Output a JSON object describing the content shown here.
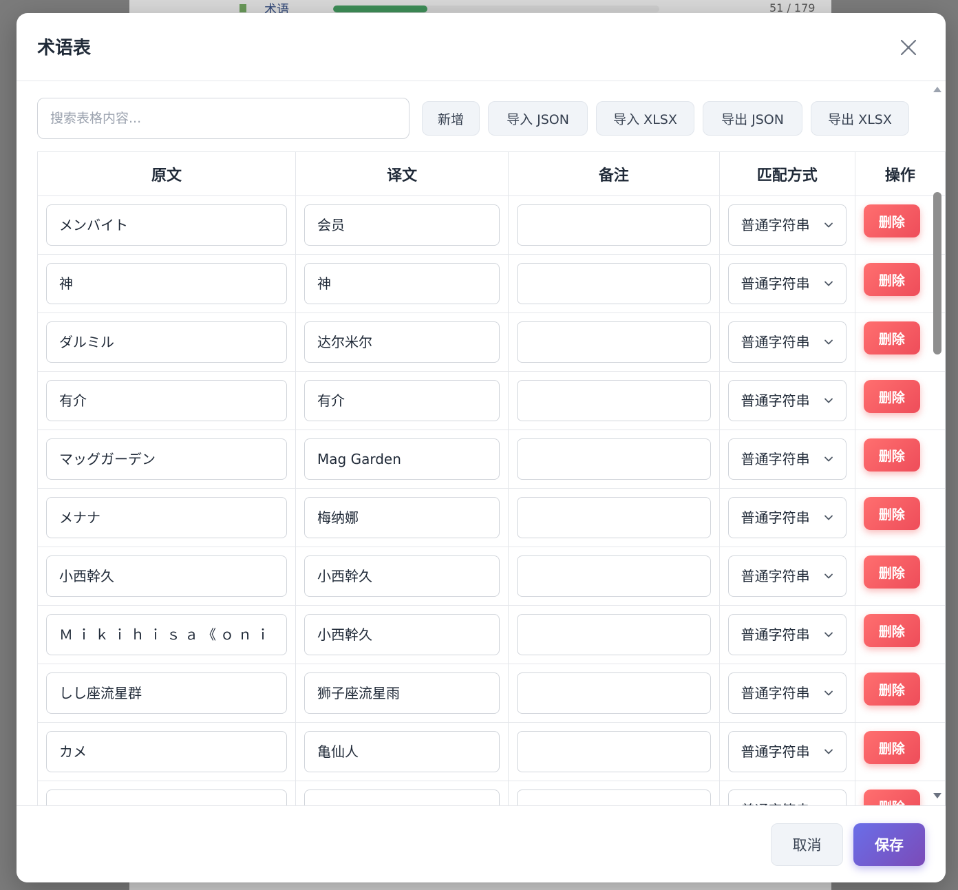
{
  "background": {
    "title": "术语",
    "count": "51 / 179",
    "progress": 0.29
  },
  "modal": {
    "title": "术语表",
    "close_icon": "close-icon",
    "search": {
      "placeholder": "搜索表格内容...",
      "value": ""
    },
    "toolbar": {
      "add_label": "新增",
      "import_json_label": "导入 JSON",
      "import_xlsx_label": "导入 XLSX",
      "export_json_label": "导出 JSON",
      "export_xlsx_label": "导出 XLSX"
    },
    "table": {
      "headers": [
        "原文",
        "译文",
        "备注",
        "匹配方式",
        "操作"
      ],
      "rows": [
        {
          "source": "メンバイト",
          "target": "会员",
          "note": "",
          "match": "普通字符串",
          "action": "删除"
        },
        {
          "source": "神",
          "target": "神",
          "note": "",
          "match": "普通字符串",
          "action": "删除"
        },
        {
          "source": "ダルミル",
          "target": "达尔米尔",
          "note": "",
          "match": "普通字符串",
          "action": "删除"
        },
        {
          "source": "有介",
          "target": "有介",
          "note": "",
          "match": "普通字符串",
          "action": "删除"
        },
        {
          "source": "マッグガーデン",
          "target": "Mag Garden",
          "note": "",
          "match": "普通字符串",
          "action": "删除"
        },
        {
          "source": "メナナ",
          "target": "梅纳娜",
          "note": "",
          "match": "普通字符串",
          "action": "删除"
        },
        {
          "source": "小西幹久",
          "target": "小西幹久",
          "note": "",
          "match": "普通字符串",
          "action": "删除"
        },
        {
          "source": "Ｍｉｋｉｈｉｓａ《ｏｎｉ",
          "target": "小西幹久",
          "note": "",
          "match": "普通字符串",
          "action": "删除"
        },
        {
          "source": "しし座流星群",
          "target": "狮子座流星雨",
          "note": "",
          "match": "普通字符串",
          "action": "删除"
        },
        {
          "source": "カメ",
          "target": "亀仙人",
          "note": "",
          "match": "普通字符串",
          "action": "删除"
        },
        {
          "source": "",
          "target": "",
          "note": "",
          "match": "普通字符串",
          "action": "删除"
        }
      ]
    },
    "footer": {
      "cancel_label": "取消",
      "save_label": "保存"
    }
  }
}
